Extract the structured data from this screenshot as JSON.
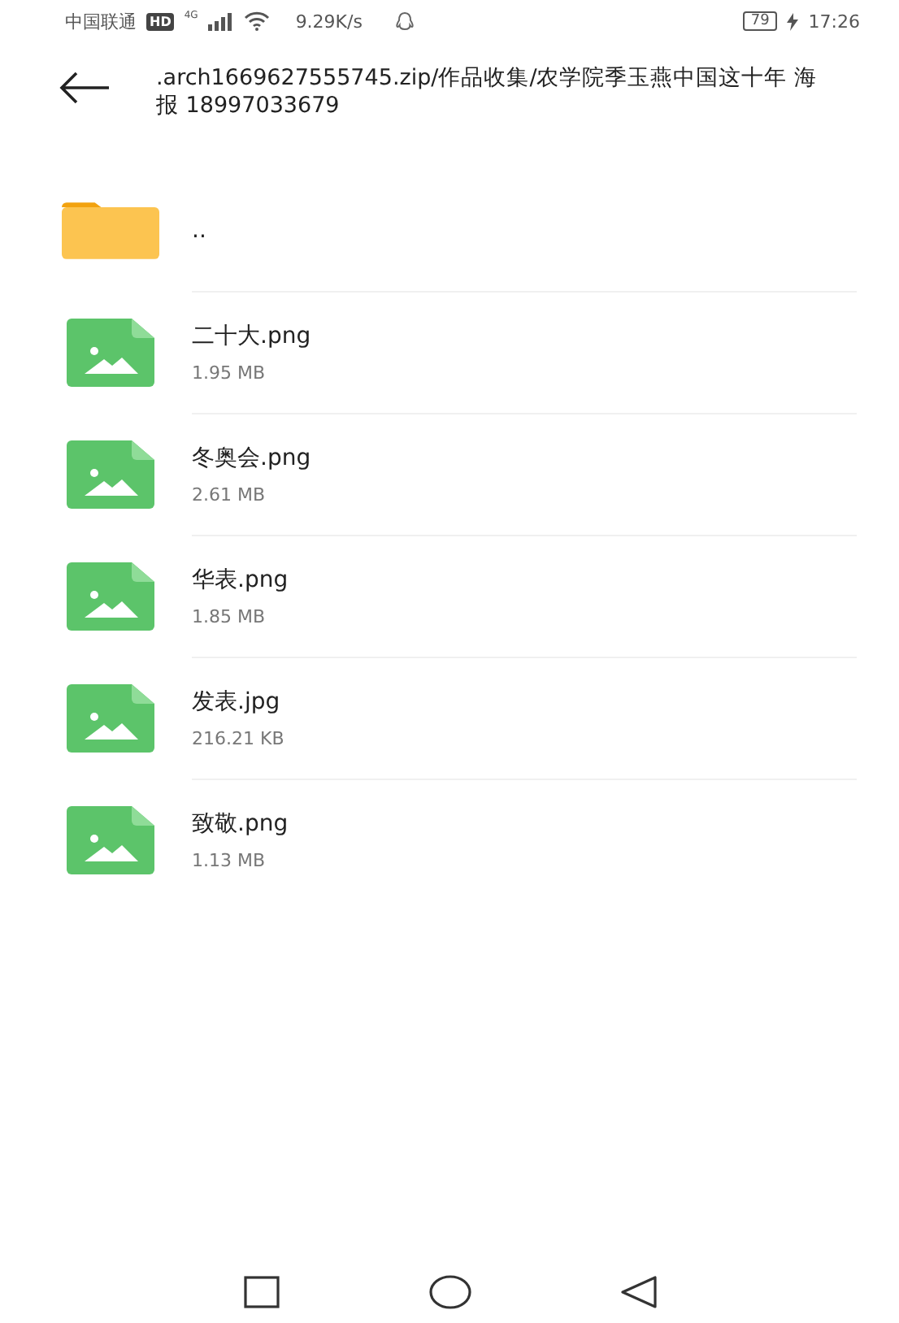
{
  "status_bar": {
    "carrier": "中国联通",
    "hd_badge": "HD",
    "network": "4G",
    "speed": "9.29K/s",
    "battery": "79",
    "time": "17:26"
  },
  "header": {
    "path": ".arch1669627555745.zip/作品收集/农学院季玉燕中国这十年 海报 18997033679"
  },
  "files": [
    {
      "kind": "folder",
      "name": ".."
    },
    {
      "kind": "image",
      "name": "二十大.png",
      "size": "1.95 MB"
    },
    {
      "kind": "image",
      "name": "冬奥会.png",
      "size": "2.61 MB"
    },
    {
      "kind": "image",
      "name": "华表.png",
      "size": "1.85 MB"
    },
    {
      "kind": "image",
      "name": "发表.jpg",
      "size": "216.21 KB"
    },
    {
      "kind": "image",
      "name": "致敬.png",
      "size": "1.13 MB"
    }
  ]
}
